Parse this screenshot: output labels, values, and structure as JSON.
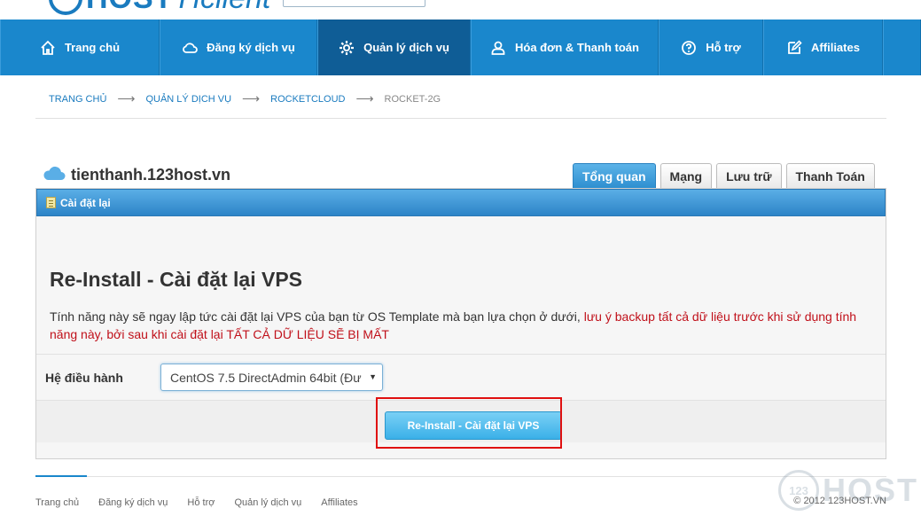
{
  "header": {
    "logo_text": "HOST",
    "logo_sub": "Hclient"
  },
  "nav": {
    "items": [
      {
        "label": "Trang chủ",
        "icon": "home-icon"
      },
      {
        "label": "Đăng ký dịch vụ",
        "icon": "cloud-icon"
      },
      {
        "label": "Quản lý dịch vụ",
        "icon": "gear-icon"
      },
      {
        "label": "Hóa đơn & Thanh toán",
        "icon": "user-icon"
      },
      {
        "label": "Hỗ trợ",
        "icon": "help-icon"
      },
      {
        "label": "Affiliates",
        "icon": "edit-icon"
      }
    ],
    "active_index": 2
  },
  "breadcrumb": {
    "items": [
      "TRANG CHỦ",
      "QUẢN LÝ DỊCH VỤ",
      "ROCKETCLOUD"
    ],
    "current": "ROCKET-2G"
  },
  "service": {
    "hostname": "tienthanh.123host.vn",
    "tabs": [
      "Tổng quan",
      "Mạng",
      "Lưu trữ",
      "Thanh Toán"
    ],
    "active_tab": 0
  },
  "panel": {
    "title": "Cài đặt lại",
    "heading": "Re-Install - Cài đặt lại VPS",
    "description": "Tính năng này sẽ ngay lập tức cài đặt lại VPS của bạn từ OS Template mà bạn lựa chọn ở dưới,",
    "warning": "lưu ý backup tất cả dữ liệu trước khi sử dụng tính năng này, bởi sau khi cài đặt lại TẤT CẢ DỮ LIỆU SẼ BỊ MẤT",
    "os_label": "Hệ điều hành",
    "os_selected": "CentOS 7.5 DirectAdmin 64bit (Đư",
    "button_label": "Re-Install - Cài đặt lại VPS"
  },
  "footer": {
    "links": [
      "Trang chủ",
      "Đăng ký dịch vụ",
      "Hỗ trợ",
      "Quản lý dịch vụ",
      "Affiliates"
    ],
    "copyright": "© 2012 123HOST.VN"
  },
  "watermark": {
    "badge": "123",
    "text": "HOST"
  },
  "colors": {
    "nav_bg": "#1a87cc",
    "nav_active": "#0f5d96",
    "link": "#1a7bbf",
    "warning": "#c0101a",
    "button": "#3ab0e8",
    "highlight": "#e01010"
  }
}
